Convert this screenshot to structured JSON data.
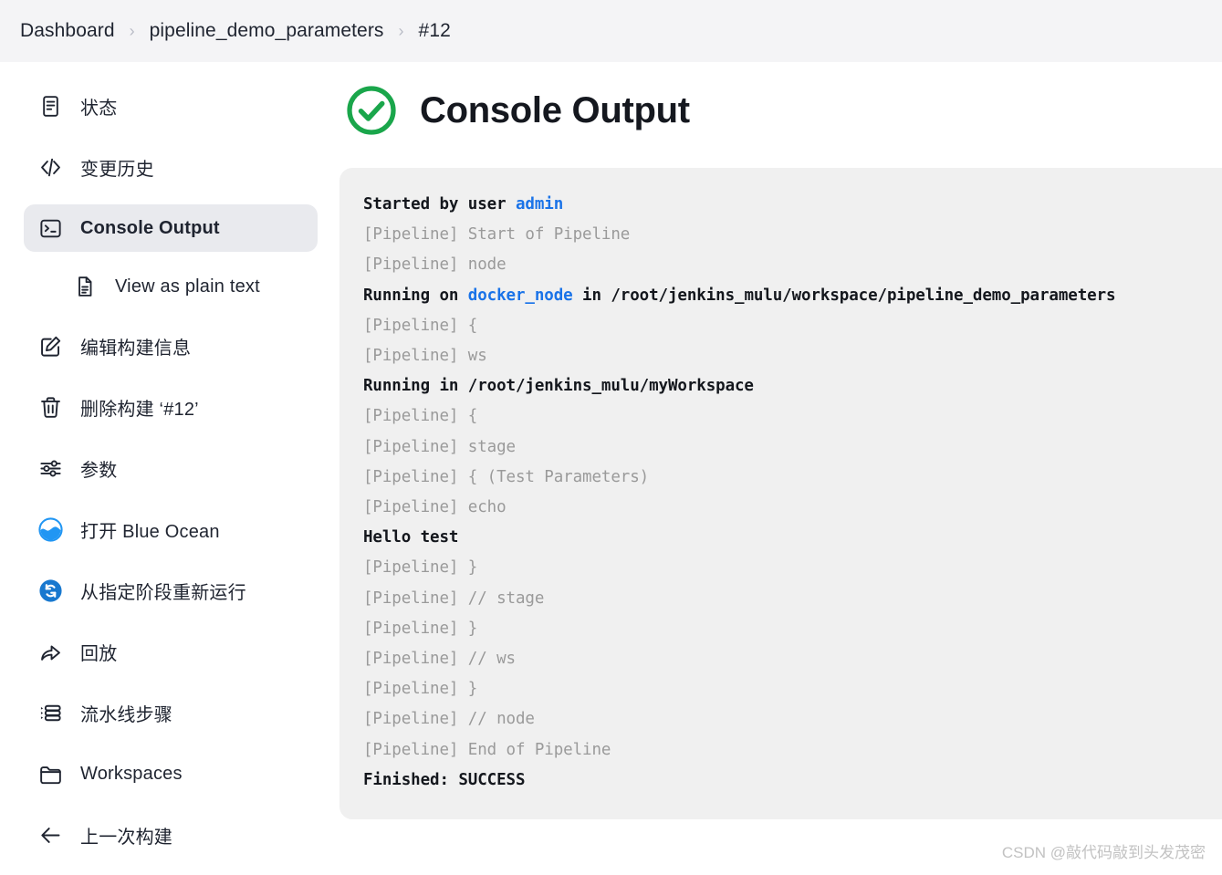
{
  "breadcrumb": {
    "items": [
      {
        "label": "Dashboard",
        "icon": "none"
      },
      {
        "label": "pipeline_demo_parameters",
        "icon": "none"
      },
      {
        "label": "#12",
        "icon": "none"
      }
    ],
    "separator": "›"
  },
  "sidebar": {
    "items": [
      {
        "label": "状态",
        "icon": "document-icon",
        "active": false,
        "sub": false
      },
      {
        "label": "变更历史",
        "icon": "code-icon",
        "active": false,
        "sub": false
      },
      {
        "label": "Console Output",
        "icon": "terminal-icon",
        "active": true,
        "sub": false
      },
      {
        "label": "View as plain text",
        "icon": "plain-text-file-icon",
        "active": false,
        "sub": true
      },
      {
        "label": "编辑构建信息",
        "icon": "edit-icon",
        "active": false,
        "sub": false
      },
      {
        "label": "删除构建 ‘#12’",
        "icon": "trash-icon",
        "active": false,
        "sub": false
      },
      {
        "label": "参数",
        "icon": "sliders-icon",
        "active": false,
        "sub": false
      },
      {
        "label": "打开 Blue Ocean",
        "icon": "blue-ocean-icon",
        "active": false,
        "sub": false
      },
      {
        "label": "从指定阶段重新运行",
        "icon": "restart-stage-icon",
        "active": false,
        "sub": false
      },
      {
        "label": "回放",
        "icon": "replay-arrow-icon",
        "active": false,
        "sub": false
      },
      {
        "label": "流水线步骤",
        "icon": "pipeline-steps-icon",
        "active": false,
        "sub": false
      },
      {
        "label": "Workspaces",
        "icon": "folder-icon",
        "active": false,
        "sub": false
      },
      {
        "label": "上一次构建",
        "icon": "arrow-left-icon",
        "active": false,
        "sub": false
      }
    ]
  },
  "main": {
    "title": "Console Output",
    "status_icon": "success-check-circle-icon",
    "status_color": "#1aa64b",
    "console_lines": [
      {
        "style": "strong",
        "parts": [
          {
            "t": "Started by user ",
            "c": "normal"
          },
          {
            "t": "admin",
            "c": "link"
          }
        ]
      },
      {
        "style": "dim",
        "parts": [
          {
            "t": "[Pipeline] Start of Pipeline",
            "c": "dim"
          }
        ]
      },
      {
        "style": "dim",
        "parts": [
          {
            "t": "[Pipeline] node",
            "c": "dim"
          }
        ]
      },
      {
        "style": "strong",
        "parts": [
          {
            "t": "Running on ",
            "c": "normal"
          },
          {
            "t": "docker_node",
            "c": "link"
          },
          {
            "t": " in /root/jenkins_mulu/workspace/pipeline_demo_parameters",
            "c": "normal"
          }
        ]
      },
      {
        "style": "dim",
        "parts": [
          {
            "t": "[Pipeline] {",
            "c": "dim"
          }
        ]
      },
      {
        "style": "dim",
        "parts": [
          {
            "t": "[Pipeline] ws",
            "c": "dim"
          }
        ]
      },
      {
        "style": "strong",
        "parts": [
          {
            "t": "Running in /root/jenkins_mulu/myWorkspace",
            "c": "normal"
          }
        ]
      },
      {
        "style": "dim",
        "parts": [
          {
            "t": "[Pipeline] {",
            "c": "dim"
          }
        ]
      },
      {
        "style": "dim",
        "parts": [
          {
            "t": "[Pipeline] stage",
            "c": "dim"
          }
        ]
      },
      {
        "style": "dim",
        "parts": [
          {
            "t": "[Pipeline] { (Test Parameters)",
            "c": "dim"
          }
        ]
      },
      {
        "style": "dim",
        "parts": [
          {
            "t": "[Pipeline] echo",
            "c": "dim"
          }
        ]
      },
      {
        "style": "strong",
        "parts": [
          {
            "t": "Hello test",
            "c": "normal"
          }
        ]
      },
      {
        "style": "dim",
        "parts": [
          {
            "t": "[Pipeline] }",
            "c": "dim"
          }
        ]
      },
      {
        "style": "dim",
        "parts": [
          {
            "t": "[Pipeline] // stage",
            "c": "dim"
          }
        ]
      },
      {
        "style": "dim",
        "parts": [
          {
            "t": "[Pipeline] }",
            "c": "dim"
          }
        ]
      },
      {
        "style": "dim",
        "parts": [
          {
            "t": "[Pipeline] // ws",
            "c": "dim"
          }
        ]
      },
      {
        "style": "dim",
        "parts": [
          {
            "t": "[Pipeline] }",
            "c": "dim"
          }
        ]
      },
      {
        "style": "dim",
        "parts": [
          {
            "t": "[Pipeline] // node",
            "c": "dim"
          }
        ]
      },
      {
        "style": "dim",
        "parts": [
          {
            "t": "[Pipeline] End of Pipeline",
            "c": "dim"
          }
        ]
      },
      {
        "style": "strong",
        "parts": [
          {
            "t": "Finished: SUCCESS",
            "c": "normal"
          }
        ]
      }
    ]
  },
  "watermark": {
    "text": "CSDN @敲代码敲到头发茂密"
  },
  "colors": {
    "header_bg": "#f4f4f6",
    "console_bg": "#f0f0f0",
    "active_item_bg": "#e9eaee",
    "link": "#1a73e8",
    "dim_text": "#9a9a9a",
    "text": "#1f2430",
    "success_green": "#1aa64b",
    "blue_ocean": "#2196f3"
  }
}
